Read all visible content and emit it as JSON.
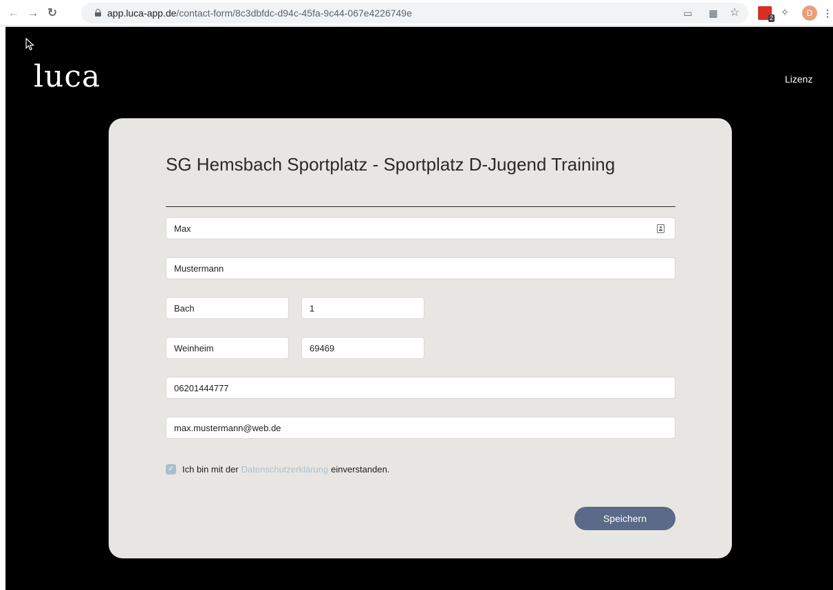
{
  "browser": {
    "url_host": "app.luca-app.de",
    "url_path": "/contact-form/8c3dbfdc-d94c-45fa-9c44-067e4226749e",
    "extension_badge": "2",
    "avatar_initial": "D",
    "icons": [
      "back-icon",
      "forward-icon",
      "reload-icon",
      "lock-icon",
      "cast-icon",
      "qr-code-icon",
      "star-icon",
      "extension-icon",
      "puzzle-icon",
      "avatar",
      "menu-icon"
    ]
  },
  "header": {
    "logo": "luca",
    "license_link": "Lizenz"
  },
  "form": {
    "title": "SG Hemsbach Sportplatz - Sportplatz D-Jugend Training",
    "first_name": "Max",
    "last_name": "Mustermann",
    "street": "Bach",
    "house_number": "1",
    "city": "Weinheim",
    "zip": "69469",
    "phone": "06201444777",
    "email": "max.mustermann@web.de",
    "consent_prefix": "Ich bin mit der",
    "consent_link": "Datenschutzerklärung",
    "consent_suffix": "einverstanden.",
    "consent_checked": true,
    "save_label": "Speichern"
  },
  "colors": {
    "page_background": "#000000",
    "card_background": "#e8e6e3",
    "button": "#5a6a88",
    "link": "#b0c1cc",
    "checkbox": "#a9bfcc"
  }
}
